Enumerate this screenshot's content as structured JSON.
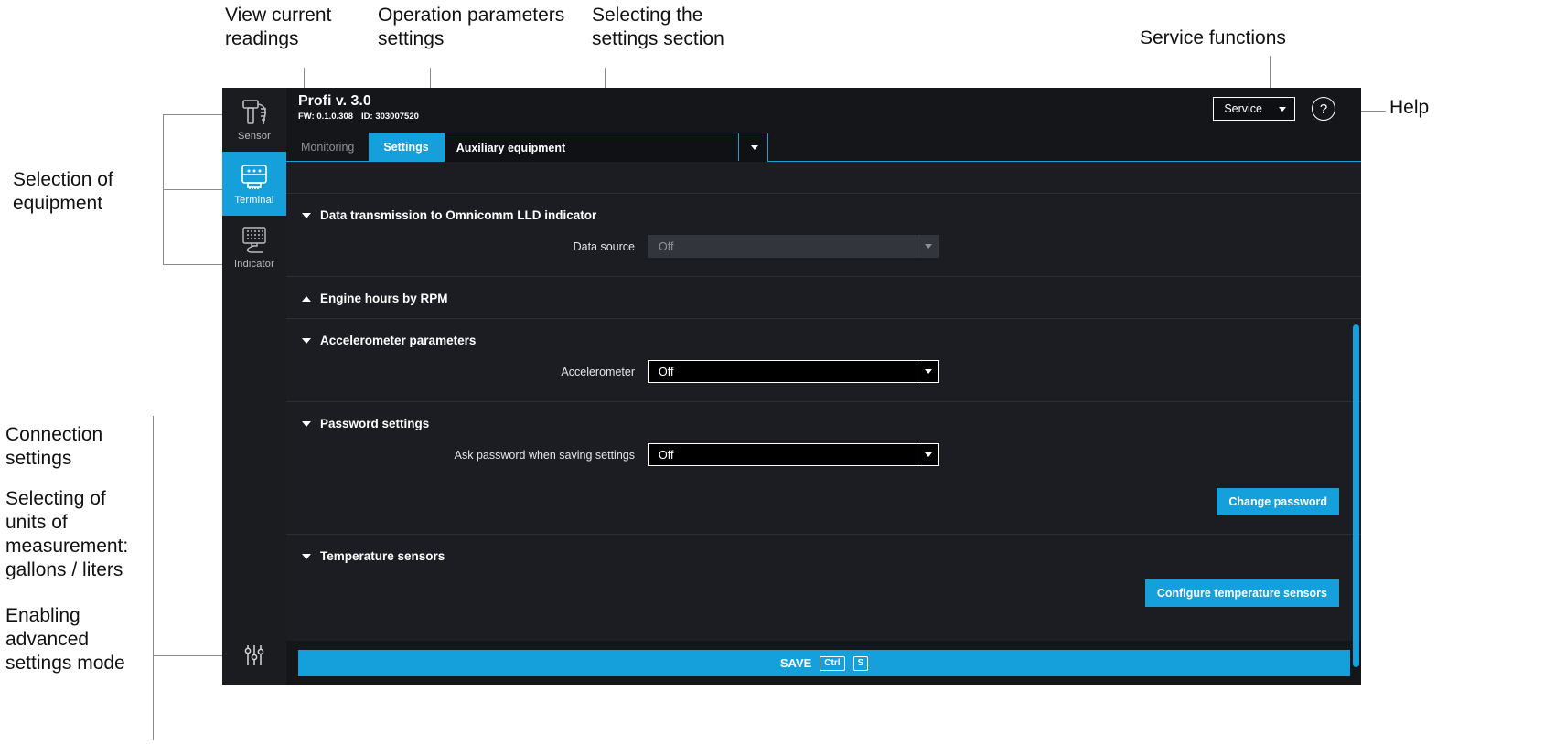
{
  "annotations": {
    "view_readings": "View current\nreadings",
    "operation_params": "Operation parameters\nsettings",
    "selecting_section": "Selecting the\nsettings section",
    "service_functions": "Service functions",
    "help": "Help",
    "selection_equipment": "Selection of\nequipment",
    "connection_settings": "Connection\nsettings",
    "units": "Selecting of\nunits of\nmeasurement:\ngallons / liters",
    "advanced": "Enabling\nadvanced\nsettings mode"
  },
  "header": {
    "title": "Profi v. 3.0",
    "firmware": "FW: 0.1.0.308",
    "device_id": "ID: 303007520",
    "service_label": "Service",
    "help_label": "?"
  },
  "rail": {
    "items": [
      {
        "label": "Sensor",
        "icon": "sensor-icon",
        "active": false
      },
      {
        "label": "Terminal",
        "icon": "terminal-icon",
        "active": true
      },
      {
        "label": "Indicator",
        "icon": "indicator-icon",
        "active": false
      }
    ],
    "bottom_icon": "sliders-icon"
  },
  "tabs": [
    {
      "label": "Monitoring",
      "active": false
    },
    {
      "label": "Settings",
      "active": true
    }
  ],
  "section_select": {
    "value": "Auxiliary equipment"
  },
  "groups": [
    {
      "title": "Data transmission to Omnicomm LLD indicator",
      "state": "expanded",
      "fields": [
        {
          "label": "Data source",
          "value": "Off",
          "disabled": true
        }
      ],
      "buttons": []
    },
    {
      "title": "Engine hours by RPM",
      "state": "collapsed",
      "fields": [],
      "buttons": []
    },
    {
      "title": "Accelerometer parameters",
      "state": "expanded",
      "fields": [
        {
          "label": "Accelerometer",
          "value": "Off",
          "disabled": false
        }
      ],
      "buttons": []
    },
    {
      "title": "Password settings",
      "state": "expanded",
      "fields": [
        {
          "label": "Ask password when saving settings",
          "value": "Off",
          "disabled": false
        }
      ],
      "buttons": [
        {
          "label": "Change password"
        }
      ]
    },
    {
      "title": "Temperature sensors",
      "state": "expanded",
      "fields": [],
      "buttons": [
        {
          "label": "Configure temperature sensors"
        }
      ]
    }
  ],
  "save": {
    "label": "SAVE",
    "key_modifier": "Ctrl",
    "key_letter": "S"
  },
  "colors": {
    "accent": "#159fdb",
    "window_bg": "#14161a",
    "content_bg": "#1b1d22"
  }
}
